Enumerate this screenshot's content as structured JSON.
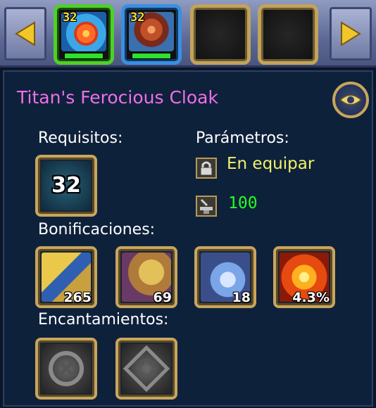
{
  "nav": {
    "prev_icon": "arrow-left-icon",
    "next_icon": "arrow-right-icon"
  },
  "slots": [
    {
      "level": "32",
      "border": "green",
      "item": "blue-swirl-item",
      "durability": 1.0
    },
    {
      "level": "32",
      "border": "blue",
      "item": "red-cloak-item",
      "durability": 1.0
    },
    {
      "level": "",
      "border": "empty"
    },
    {
      "level": "",
      "border": "empty"
    }
  ],
  "item": {
    "name": "Titan's Ferocious Cloak",
    "name_color": "#ee6fe8",
    "view_icon": "eye-icon"
  },
  "requirements": {
    "label": "Requisitos:",
    "level": "32"
  },
  "parameters": {
    "label": "Parámetros:",
    "bind_text": "En equipar",
    "bind_color": "#f2f26a",
    "bind_icon": "lock-icon",
    "durability_value": "100",
    "durability_color": "#22ff22",
    "durability_icon": "anvil-icon"
  },
  "bonuses": {
    "label": "Bonificaciones:",
    "items": [
      {
        "icon": "armor-icon",
        "value": "265"
      },
      {
        "icon": "strength-arm-icon",
        "value": "69"
      },
      {
        "icon": "tornado-icon",
        "value": "18"
      },
      {
        "icon": "fire-swirl-icon",
        "value": "4.3%"
      }
    ]
  },
  "enchantments": {
    "label": "Encantamientos:",
    "items": [
      {
        "icon": "empty-rune-socket-icon"
      },
      {
        "icon": "empty-rune-socket-icon"
      }
    ]
  }
}
